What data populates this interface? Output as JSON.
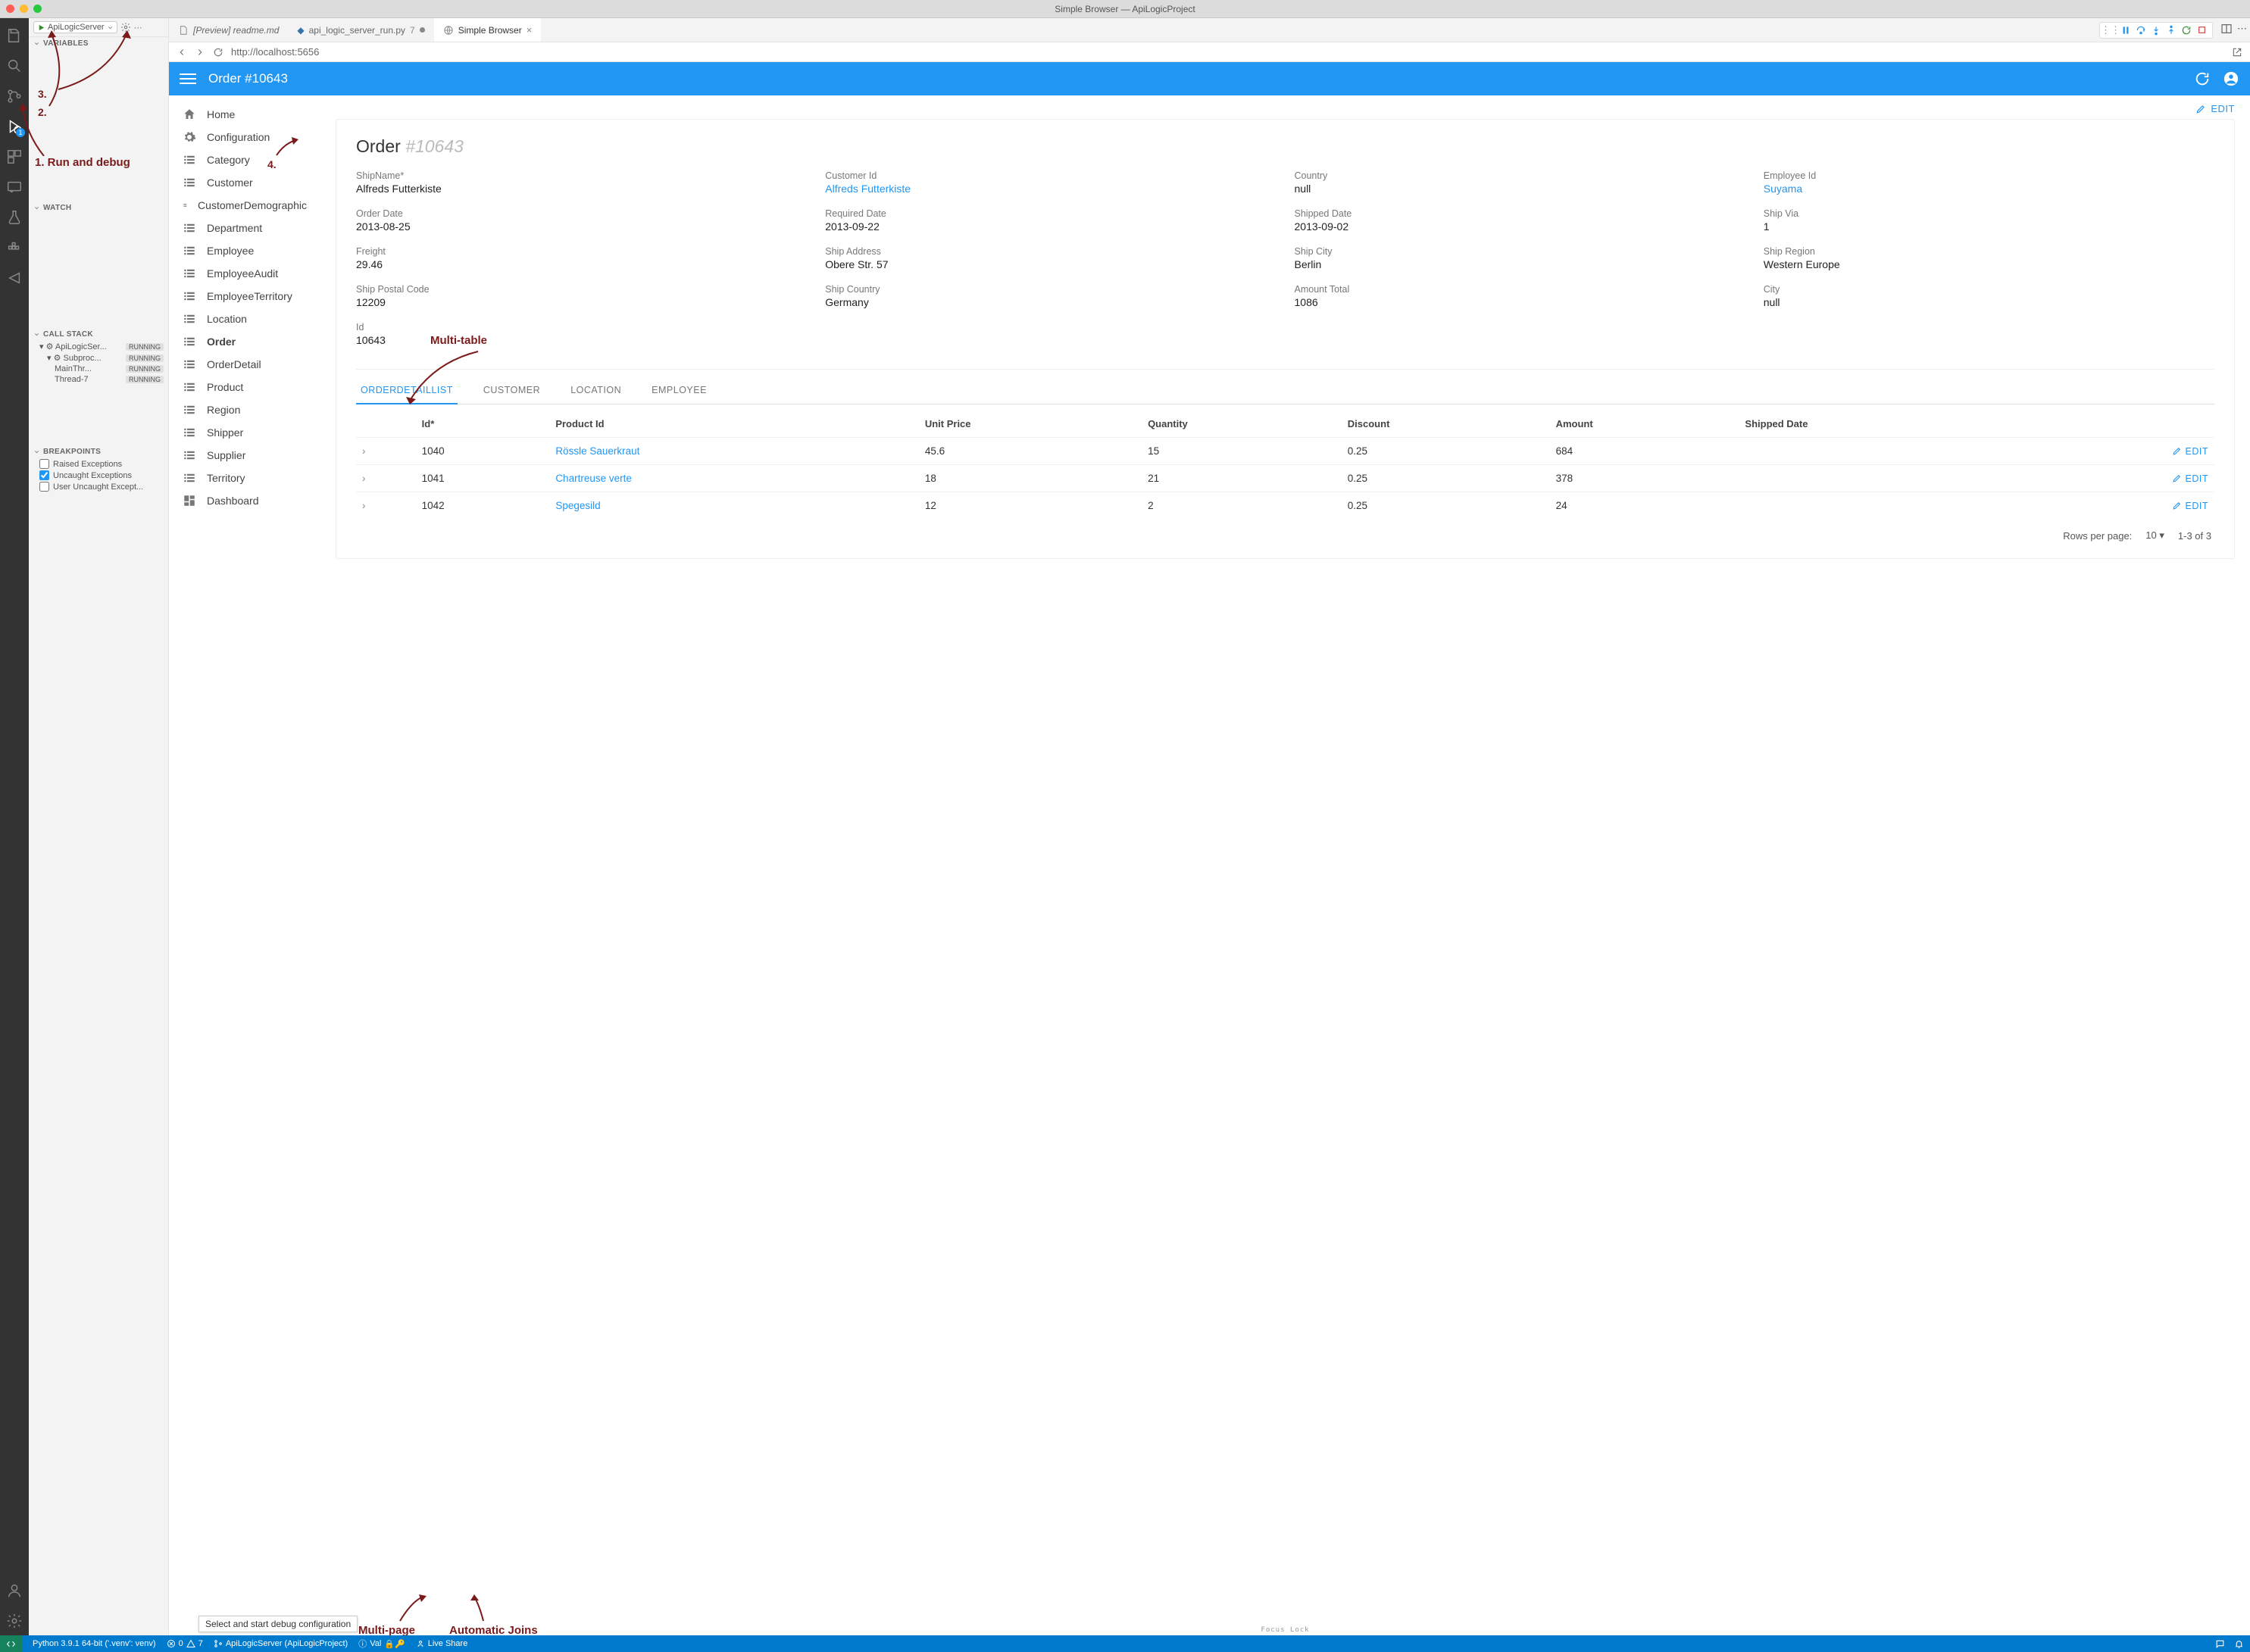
{
  "window_title": "Simple Browser — ApiLogicProject",
  "debug_config": "ApiLogicServer",
  "side_sections": {
    "variables": "VARIABLES",
    "watch": "WATCH",
    "callstack": "CALL STACK",
    "breakpoints": "BREAKPOINTS"
  },
  "callstack": [
    {
      "name": "ApiLogicSer...",
      "status": "RUNNING",
      "indent": 0,
      "icon": "gear"
    },
    {
      "name": "Subproc...",
      "status": "RUNNING",
      "indent": 1,
      "icon": "gear"
    },
    {
      "name": "MainThr...",
      "status": "RUNNING",
      "indent": 2
    },
    {
      "name": "Thread-7",
      "status": "RUNNING",
      "indent": 2
    }
  ],
  "breakpoints": [
    {
      "label": "Raised Exceptions",
      "checked": false
    },
    {
      "label": "Uncaught Exceptions",
      "checked": true
    },
    {
      "label": "User Uncaught Except...",
      "checked": false
    }
  ],
  "tabs": [
    {
      "label": "[Preview] readme.md",
      "icon": "file",
      "italic": true
    },
    {
      "label": "api_logic_server_run.py",
      "icon": "python",
      "suffix": "7",
      "modified": true
    },
    {
      "label": "Simple Browser",
      "icon": "globe",
      "active": true,
      "closeable": true
    }
  ],
  "url": "http://localhost:5656",
  "app_title": "Order #10643",
  "nav_items": [
    {
      "label": "Home",
      "icon": "home"
    },
    {
      "label": "Configuration",
      "icon": "gear"
    },
    {
      "label": "Category",
      "icon": "list"
    },
    {
      "label": "Customer",
      "icon": "list"
    },
    {
      "label": "CustomerDemographic",
      "icon": "list"
    },
    {
      "label": "Department",
      "icon": "list"
    },
    {
      "label": "Employee",
      "icon": "list"
    },
    {
      "label": "EmployeeAudit",
      "icon": "list"
    },
    {
      "label": "EmployeeTerritory",
      "icon": "list"
    },
    {
      "label": "Location",
      "icon": "list"
    },
    {
      "label": "Order",
      "icon": "list",
      "bold": true
    },
    {
      "label": "OrderDetail",
      "icon": "list"
    },
    {
      "label": "Product",
      "icon": "list"
    },
    {
      "label": "Region",
      "icon": "list"
    },
    {
      "label": "Shipper",
      "icon": "list"
    },
    {
      "label": "Supplier",
      "icon": "list"
    },
    {
      "label": "Territory",
      "icon": "list"
    },
    {
      "label": "Dashboard",
      "icon": "dash"
    }
  ],
  "edit_label": "EDIT",
  "order_heading": "Order ",
  "order_heading_grey": "#10643",
  "fields": [
    {
      "label": "ShipName*",
      "value": "Alfreds Futterkiste"
    },
    {
      "label": "Customer Id",
      "value": "Alfreds Futterkiste",
      "link": true
    },
    {
      "label": "Country",
      "value": "null"
    },
    {
      "label": "Employee Id",
      "value": "Suyama",
      "link": true
    },
    {
      "label": "Order Date",
      "value": "2013-08-25"
    },
    {
      "label": "Required Date",
      "value": "2013-09-22"
    },
    {
      "label": "Shipped Date",
      "value": "2013-09-02"
    },
    {
      "label": "Ship Via",
      "value": "1"
    },
    {
      "label": "Freight",
      "value": "29.46"
    },
    {
      "label": "Ship Address",
      "value": "Obere Str. 57"
    },
    {
      "label": "Ship City",
      "value": "Berlin"
    },
    {
      "label": "Ship Region",
      "value": "Western Europe"
    },
    {
      "label": "Ship Postal Code",
      "value": "12209"
    },
    {
      "label": "Ship Country",
      "value": "Germany"
    },
    {
      "label": "Amount Total",
      "value": "1086"
    },
    {
      "label": "City",
      "value": "null"
    },
    {
      "label": "Id",
      "value": "10643"
    }
  ],
  "inner_tabs": [
    "ORDERDETAILLIST",
    "CUSTOMER",
    "LOCATION",
    "EMPLOYEE"
  ],
  "columns": [
    "",
    "Id*",
    "Product Id",
    "Unit Price",
    "Quantity",
    "Discount",
    "Amount",
    "Shipped Date",
    ""
  ],
  "rows": [
    {
      "id": "1040",
      "product": "Rössle Sauerkraut",
      "unit": "45.6",
      "qty": "15",
      "disc": "0.25",
      "amt": "684",
      "shipped": ""
    },
    {
      "id": "1041",
      "product": "Chartreuse verte",
      "unit": "18",
      "qty": "21",
      "disc": "0.25",
      "amt": "378",
      "shipped": ""
    },
    {
      "id": "1042",
      "product": "Spegesild",
      "unit": "12",
      "qty": "2",
      "disc": "0.25",
      "amt": "24",
      "shipped": ""
    }
  ],
  "rows_per_page_label": "Rows per page:",
  "rows_per_page": "10",
  "page_range": "1-3 of 3",
  "status": {
    "remote_section": "",
    "python": "Python 3.9.1 64-bit ('.venv': venv)",
    "errors": "0",
    "warnings": "7",
    "project": "ApiLogicServer (ApiLogicProject)",
    "val": "Val",
    "liveshare": "Live Share"
  },
  "annotations": {
    "a1": "1. Run and debug",
    "a2": "2.",
    "a3": "3.",
    "a4": "4.",
    "multitable": "Multi-table",
    "multipage": "Multi-page",
    "autojoins": "Automatic Joins"
  },
  "tooltip": "Select and start debug configuration",
  "focus_lock": "Focus Lock"
}
